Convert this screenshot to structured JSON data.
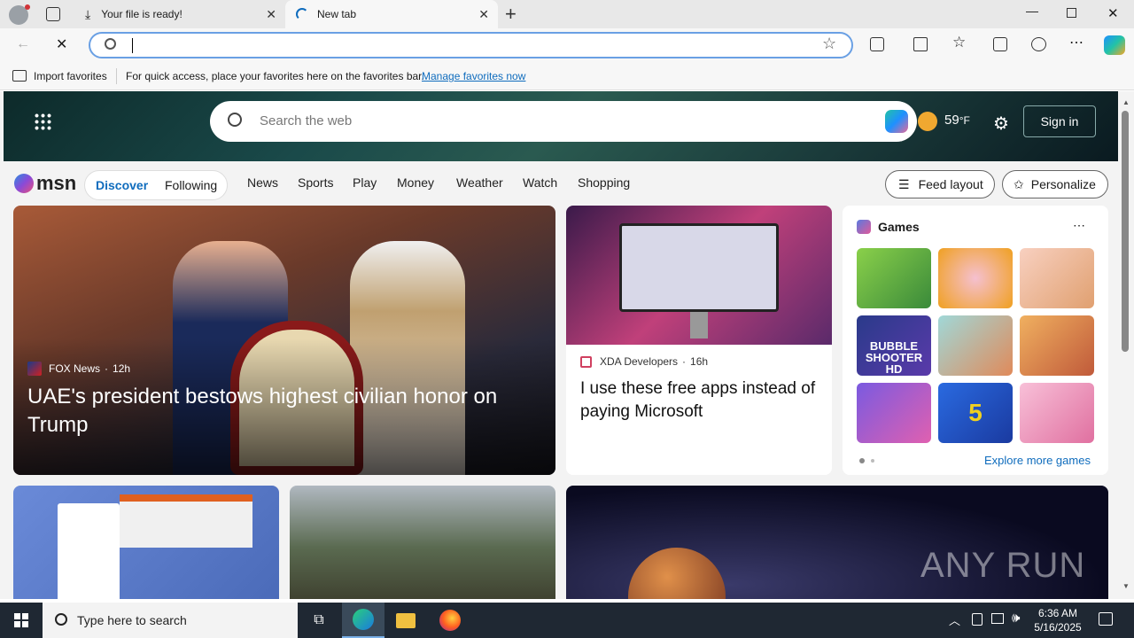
{
  "tabs": [
    {
      "title": "Your file is ready!",
      "icon": "download-icon"
    },
    {
      "title": "New tab",
      "icon": "loading-icon"
    }
  ],
  "new_tab_label": "+",
  "favbar": {
    "import_label": "Import favorites",
    "message": "For quick access, place your favorites here on the favorites bar.",
    "manage_link": "Manage favorites now"
  },
  "msn": {
    "search_placeholder": "Search the web",
    "weather_temp": "59",
    "weather_unit": "°F",
    "sign_in": "Sign in",
    "logo_text": "msn",
    "pills": [
      "Discover",
      "Following"
    ],
    "nav": [
      "News",
      "Sports",
      "Play",
      "Money",
      "Weather",
      "Watch",
      "Shopping"
    ],
    "feed_layout": "Feed layout",
    "personalize": "Personalize"
  },
  "hero_story": {
    "source": "FOX News",
    "age": "12h",
    "headline": "UAE's president bestows highest civilian honor on Trump"
  },
  "side_story": {
    "source": "XDA Developers",
    "age": "16h",
    "headline": "I use these free apps instead of paying Microsoft"
  },
  "games": {
    "title": "Games",
    "more_link": "Explore more games",
    "tiles": [
      {
        "label": ""
      },
      {
        "label": ""
      },
      {
        "label": ""
      },
      {
        "label": "BUBBLE SHOOTER HD"
      },
      {
        "label": ""
      },
      {
        "label": ""
      },
      {
        "label": ""
      },
      {
        "label": "5"
      },
      {
        "label": ""
      }
    ]
  },
  "watermark": "ANY RUN",
  "taskbar": {
    "search_placeholder": "Type here to search",
    "time": "6:36 AM",
    "date": "5/16/2025"
  },
  "colors": {
    "accent": "#0f6cbd",
    "taskbar": "#1f2833"
  }
}
